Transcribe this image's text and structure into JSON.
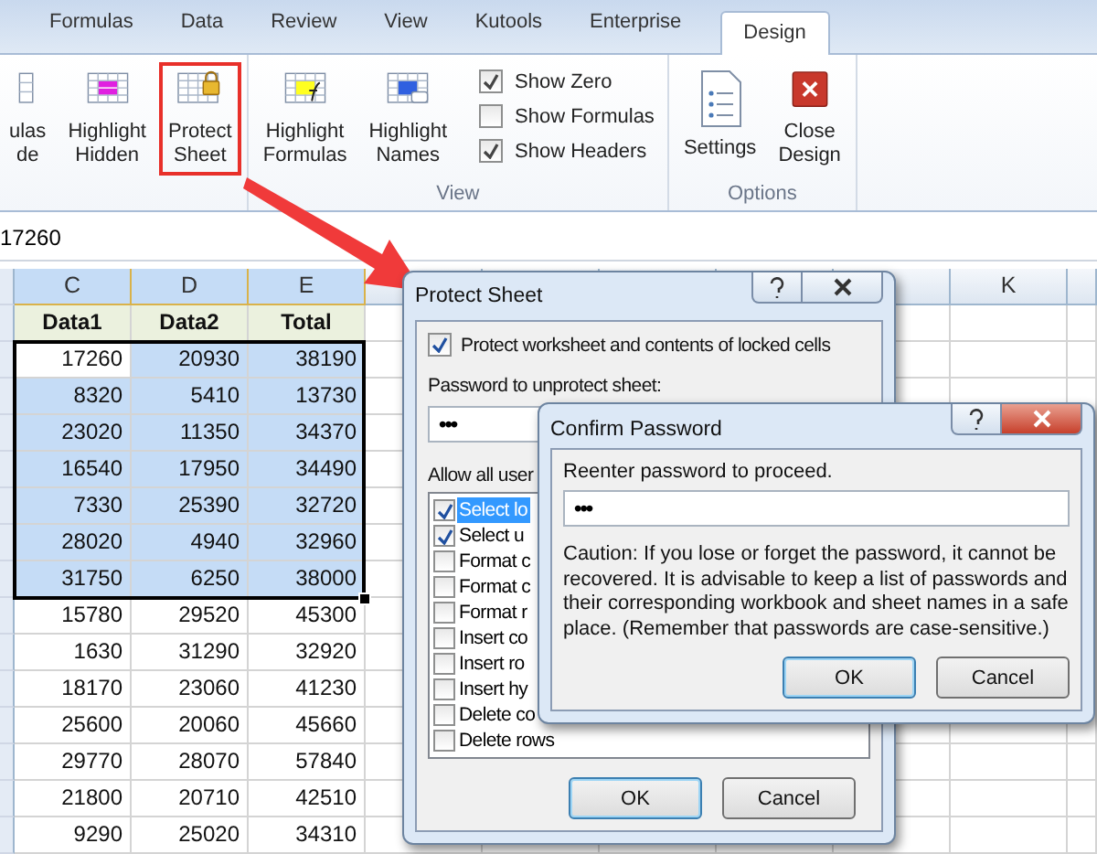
{
  "ribbon_tabs": [
    {
      "label": "Formulas",
      "selected": false
    },
    {
      "label": "Data",
      "selected": false
    },
    {
      "label": "Review",
      "selected": false
    },
    {
      "label": "View",
      "selected": false
    },
    {
      "label": "Kutools",
      "selected": false
    },
    {
      "label": "Enterprise",
      "selected": false
    },
    {
      "label": "Design",
      "selected": true
    }
  ],
  "ribbon": {
    "buttons": [
      {
        "kind": "partial",
        "lines": [
          "ulas",
          "de"
        ],
        "highlighted": false
      },
      {
        "kind": "highlight-hidden",
        "lines": [
          "Highlight",
          "Hidden"
        ],
        "highlighted": false
      },
      {
        "kind": "protect",
        "lines": [
          "Protect",
          "Sheet"
        ],
        "highlighted": true
      },
      {
        "kind": "highlight-formulas",
        "lines": [
          "Highlight",
          "Formulas"
        ],
        "highlighted": false
      },
      {
        "kind": "highlight-names",
        "lines": [
          "Highlight",
          "Names"
        ],
        "highlighted": false
      }
    ],
    "checkboxes": [
      {
        "label": "Show Zero",
        "checked": true
      },
      {
        "label": "Show Formulas",
        "checked": false
      },
      {
        "label": "Show Headers",
        "checked": true
      }
    ],
    "view_group_label": "View",
    "option_buttons": [
      {
        "kind": "settings",
        "lines": [
          "Settings"
        ],
        "highlighted": false
      },
      {
        "kind": "close",
        "lines": [
          "Close",
          "Design"
        ],
        "highlighted": false
      }
    ],
    "options_group_label": "Options"
  },
  "formula_bar": {
    "value": "17260"
  },
  "sheet": {
    "columns": [
      {
        "header": "C",
        "selected": true
      },
      {
        "header": "D",
        "selected": true
      },
      {
        "header": "E",
        "selected": true
      }
    ],
    "far_column": {
      "header": "K",
      "selected": false
    },
    "header_row": [
      "Data1",
      "Data2",
      "Total"
    ],
    "rows": [
      {
        "cells": [
          "17260",
          "20930",
          "38190"
        ],
        "selected": true
      },
      {
        "cells": [
          "8320",
          "5410",
          "13730"
        ],
        "selected": true
      },
      {
        "cells": [
          "23020",
          "11350",
          "34370"
        ],
        "selected": true
      },
      {
        "cells": [
          "16540",
          "17950",
          "34490"
        ],
        "selected": true
      },
      {
        "cells": [
          "7330",
          "25390",
          "32720"
        ],
        "selected": true
      },
      {
        "cells": [
          "28020",
          "4940",
          "32960"
        ],
        "selected": true
      },
      {
        "cells": [
          "31750",
          "6250",
          "38000"
        ],
        "selected": true
      },
      {
        "cells": [
          "15780",
          "29520",
          "45300"
        ],
        "selected": false
      },
      {
        "cells": [
          "1630",
          "31290",
          "32920"
        ],
        "selected": false
      },
      {
        "cells": [
          "18170",
          "23060",
          "41230"
        ],
        "selected": false
      },
      {
        "cells": [
          "25600",
          "20060",
          "45660"
        ],
        "selected": false
      },
      {
        "cells": [
          "29770",
          "28070",
          "57840"
        ],
        "selected": false
      },
      {
        "cells": [
          "21800",
          "20710",
          "42510"
        ],
        "selected": false
      },
      {
        "cells": [
          "9290",
          "25020",
          "34310"
        ],
        "selected": false
      }
    ]
  },
  "protect_dialog": {
    "title": "Protect Sheet",
    "protect_option": {
      "label": "Protect worksheet and contents of locked cells",
      "checked": true
    },
    "password_label": "Password to unprotect sheet:",
    "password_value": "•••",
    "allow_label": "Allow all user",
    "permissions": [
      {
        "label": "Select lo",
        "checked": true,
        "selected": true
      },
      {
        "label": "Select u",
        "checked": true,
        "selected": false
      },
      {
        "label": "Format c",
        "checked": false,
        "selected": false
      },
      {
        "label": "Format c",
        "checked": false,
        "selected": false
      },
      {
        "label": "Format r",
        "checked": false,
        "selected": false
      },
      {
        "label": "Insert co",
        "checked": false,
        "selected": false
      },
      {
        "label": "Insert ro",
        "checked": false,
        "selected": false
      },
      {
        "label": "Insert hy",
        "checked": false,
        "selected": false
      },
      {
        "label": "Delete co",
        "checked": false,
        "selected": false
      },
      {
        "label": "Delete rows",
        "checked": false,
        "selected": false
      }
    ],
    "buttons": [
      "OK",
      "Cancel"
    ]
  },
  "confirm_dialog": {
    "title": "Confirm Password",
    "prompt": "Reenter password to proceed.",
    "password_value": "•••",
    "caution": "Caution: If you lose or forget the password, it cannot be recovered. It is advisable to keep a list of passwords and their corresponding workbook and sheet names in a safe place.  (Remember that passwords are case-sensitive.)",
    "buttons": [
      "OK",
      "Cancel"
    ]
  }
}
